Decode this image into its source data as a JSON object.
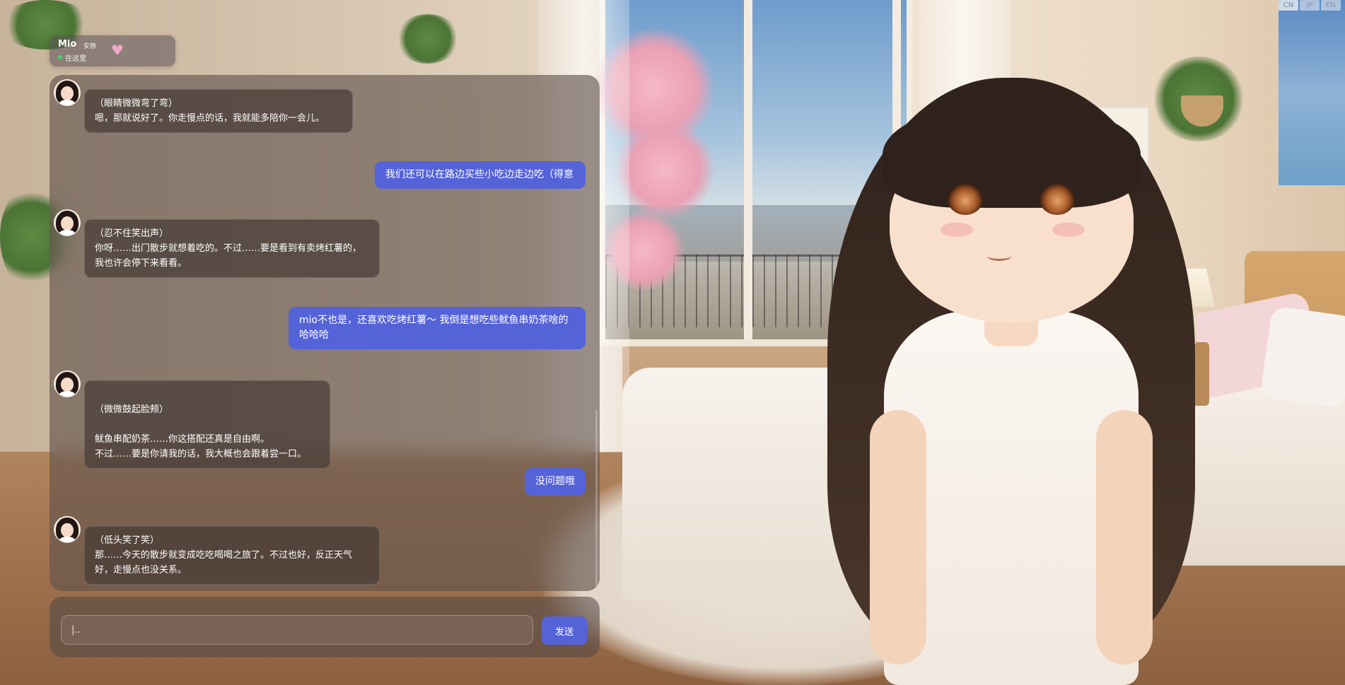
{
  "language_switcher": {
    "options": [
      "CN",
      "JP",
      "EN"
    ],
    "active": "CN"
  },
  "header": {
    "name": "Mio",
    "mood": "安静",
    "status": "在这里",
    "status_color": "#43d06a",
    "icon": "heart-icon"
  },
  "chat": {
    "messages": [
      {
        "role": "assistant",
        "action": "（眼睛微微弯了弯）",
        "text": "嗯，那就说好了。你走慢点的话，我就能多陪你一会儿。"
      },
      {
        "role": "user",
        "text": "我们还可以在路边买些小吃边走边吃（得意"
      },
      {
        "role": "assistant",
        "action": "（忍不住笑出声）",
        "text": "你呀……出门散步就想着吃的。不过……要是看到有卖烤红薯的，我也许会停下来看看。"
      },
      {
        "role": "user",
        "text": "mio不也是，还喜欢吃烤红薯～ 我倒是想吃些鱿鱼串奶茶啥的哈哈哈"
      },
      {
        "role": "assistant",
        "action": "（微微鼓起脸颊）",
        "text": "鱿鱼串配奶茶……你这搭配还真是自由啊。\n不过……要是你请我的话，我大概也会跟着尝一口。"
      },
      {
        "role": "user",
        "text": "没问题哦"
      },
      {
        "role": "assistant",
        "action": "（低头笑了笑）",
        "text": "那……今天的散步就变成吃吃喝喝之旅了。不过也好，反正天气好，走慢点也没关系。"
      }
    ]
  },
  "input": {
    "placeholder": "|..",
    "value": ""
  },
  "send_button": {
    "label": "发送"
  },
  "colors": {
    "accent": "#5563d9",
    "panel_bg": "rgba(95,80,75,0.62)",
    "heart": "#f0a7c6"
  }
}
